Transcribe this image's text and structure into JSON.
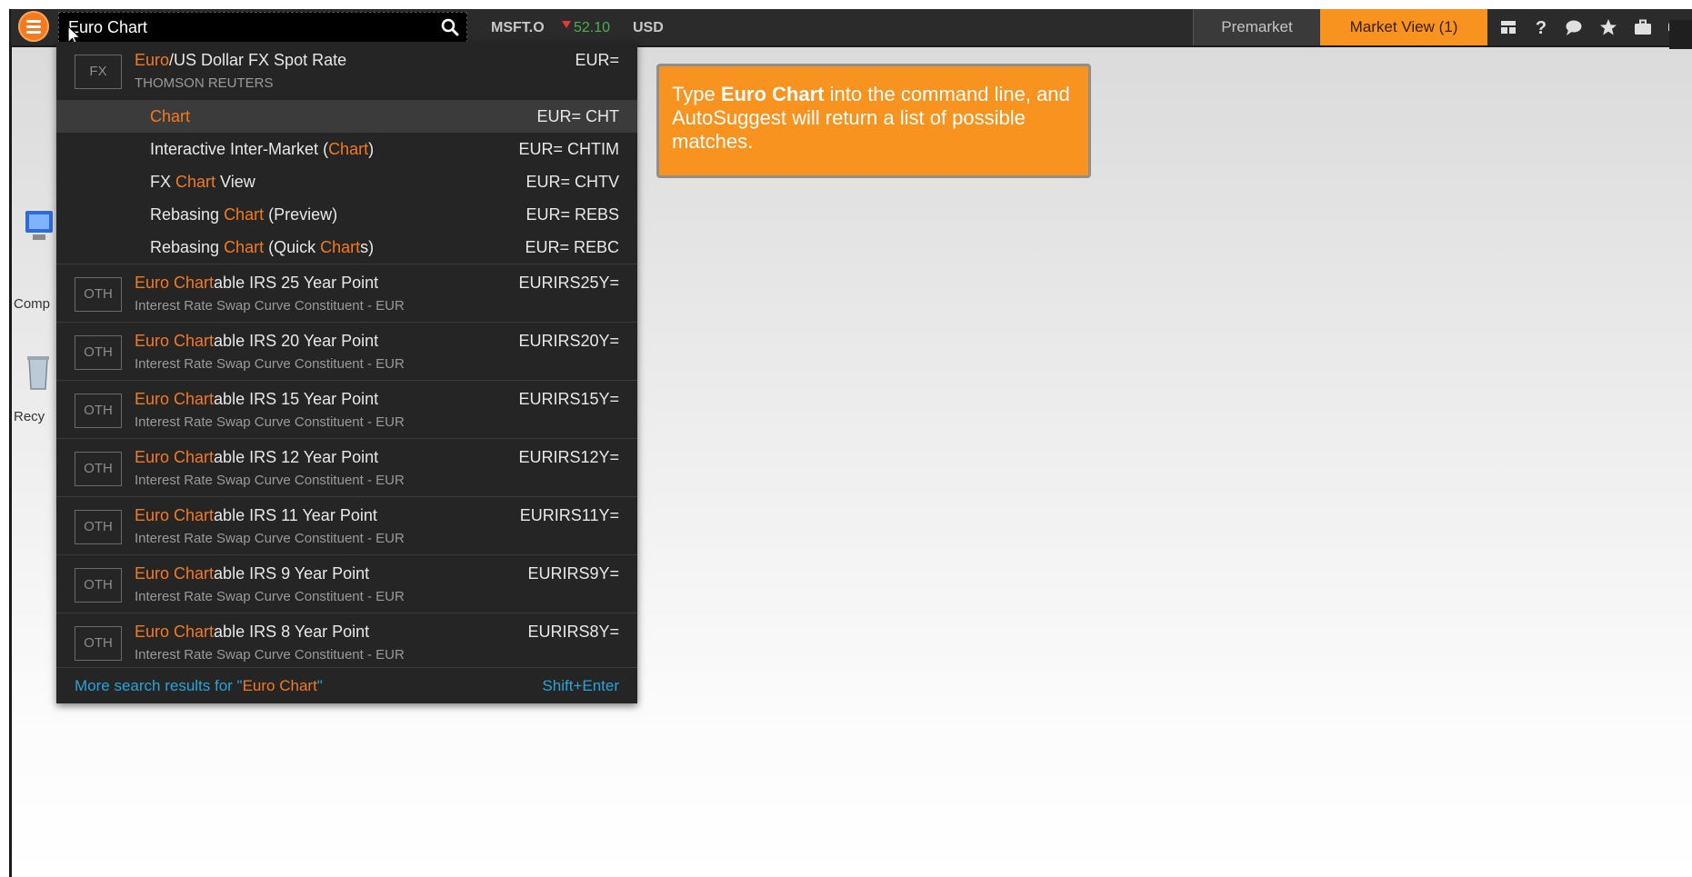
{
  "search": {
    "value": "Euro Chart"
  },
  "ticker": {
    "symbol": "MSFT.O",
    "change": "52.10",
    "currency": "USD"
  },
  "tabs": [
    {
      "label": "Premarket"
    },
    {
      "label": "Market View (1)"
    }
  ],
  "dropdown": {
    "fx_result": {
      "badge": "FX",
      "title_hl": "Euro",
      "title_rest": "/US Dollar FX Spot Rate",
      "subtitle": "THOMSON REUTERS",
      "code": "EUR="
    },
    "sub_items": [
      {
        "pre": "",
        "hl": "Chart",
        "post": "",
        "hl2": "",
        "post2": "",
        "code": "EUR= CHT"
      },
      {
        "pre": "Interactive Inter-Market (",
        "hl": "Chart",
        "post": ")",
        "hl2": "",
        "post2": "",
        "code": "EUR= CHTIM"
      },
      {
        "pre": "FX ",
        "hl": "Chart",
        "post": " View",
        "hl2": "",
        "post2": "",
        "code": "EUR= CHTV"
      },
      {
        "pre": "Rebasing ",
        "hl": "Chart",
        "post": " (Preview)",
        "hl2": "",
        "post2": "",
        "code": "EUR= REBS"
      },
      {
        "pre": "Rebasing ",
        "hl": "Chart",
        "post": " (Quick ",
        "hl2": "Chart",
        "post2": "s)",
        "code": "EUR= REBC"
      }
    ],
    "oth_results": [
      {
        "badge": "OTH",
        "hl": "Euro Chart",
        "rest": "able IRS 25 Year Point",
        "subtitle": "Interest Rate Swap Curve Constituent - EUR",
        "code": "EURIRS25Y="
      },
      {
        "badge": "OTH",
        "hl": "Euro Chart",
        "rest": "able IRS 20 Year Point",
        "subtitle": "Interest Rate Swap Curve Constituent - EUR",
        "code": "EURIRS20Y="
      },
      {
        "badge": "OTH",
        "hl": "Euro Chart",
        "rest": "able IRS 15 Year Point",
        "subtitle": "Interest Rate Swap Curve Constituent - EUR",
        "code": "EURIRS15Y="
      },
      {
        "badge": "OTH",
        "hl": "Euro Chart",
        "rest": "able IRS 12 Year Point",
        "subtitle": "Interest Rate Swap Curve Constituent - EUR",
        "code": "EURIRS12Y="
      },
      {
        "badge": "OTH",
        "hl": "Euro Chart",
        "rest": "able IRS 11 Year Point",
        "subtitle": "Interest Rate Swap Curve Constituent - EUR",
        "code": "EURIRS11Y="
      },
      {
        "badge": "OTH",
        "hl": "Euro Chart",
        "rest": "able IRS 9 Year Point",
        "subtitle": "Interest Rate Swap Curve Constituent - EUR",
        "code": "EURIRS9Y="
      },
      {
        "badge": "OTH",
        "hl": "Euro Chart",
        "rest": "able IRS 8 Year Point",
        "subtitle": "Interest Rate Swap Curve Constituent - EUR",
        "code": "EURIRS8Y="
      }
    ],
    "more": {
      "prefix": "More search results for \"",
      "query": "Euro Chart",
      "suffix": "\"",
      "shortcut": "Shift+Enter"
    }
  },
  "callout": {
    "pre": "Type ",
    "bold": "Euro Chart",
    "post": " into the command line, and AutoSuggest will return a list of possible matches."
  },
  "colors": {
    "accent_orange": "#f47a1f",
    "tab_active": "#f7931e",
    "link_blue": "#2aa3d8",
    "ticker_up_green": "#4caf50",
    "ticker_down_red": "#e23a3a"
  }
}
